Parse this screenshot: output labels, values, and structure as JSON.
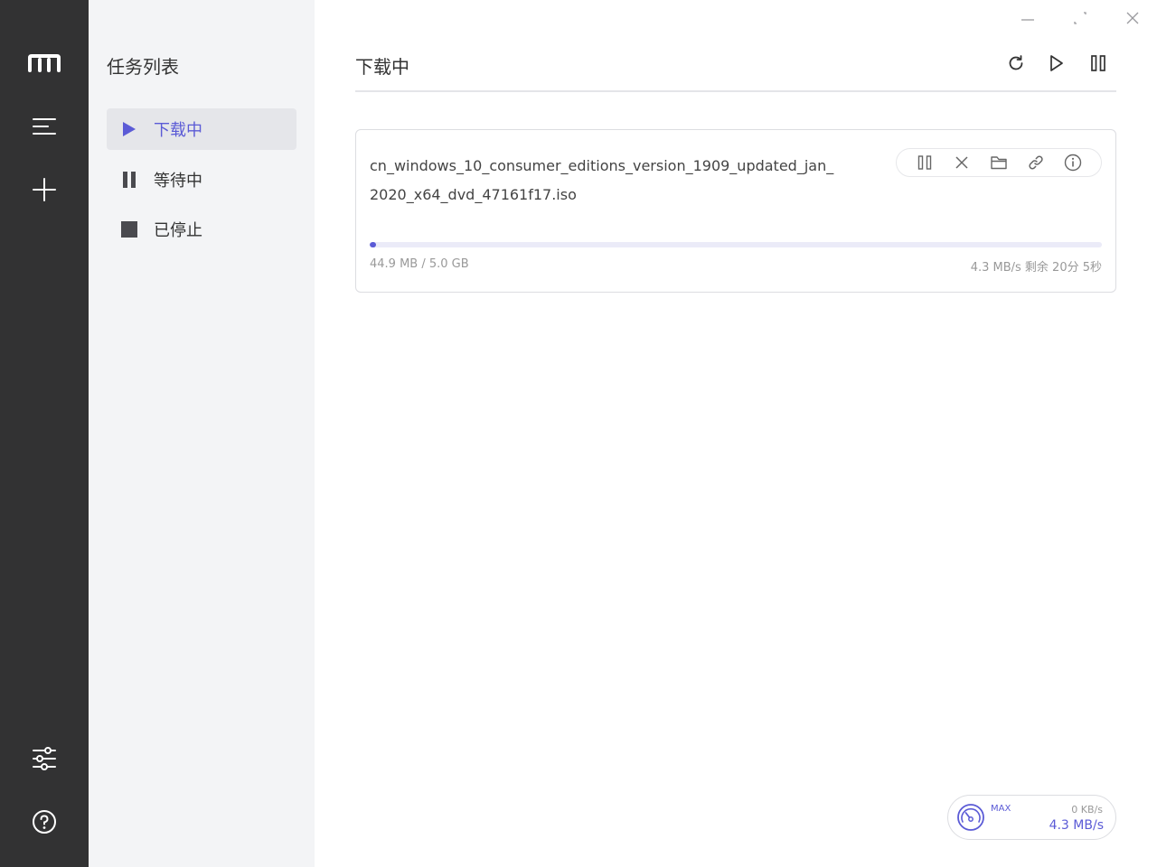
{
  "nav_rail": {
    "icons": [
      "app-logo-icon",
      "menu-icon",
      "add-task-icon",
      "settings-icon",
      "help-icon"
    ]
  },
  "sidebar": {
    "title": "任务列表",
    "items": [
      {
        "label": "下载中",
        "icon": "play-icon",
        "active": true
      },
      {
        "label": "等待中",
        "icon": "pause-icon",
        "active": false
      },
      {
        "label": "已停止",
        "icon": "stop-icon",
        "active": false
      }
    ]
  },
  "header": {
    "title": "下载中",
    "actions": [
      "refresh-icon",
      "resume-all-icon",
      "pause-all-icon"
    ]
  },
  "task": {
    "name": "cn_windows_10_consumer_editions_version_1909_updated_jan_2020_x64_dvd_47161f17.iso",
    "size_text": "44.9 MB / 5.0 GB",
    "speed_text": "4.3 MB/s 剩余 20分 5秒",
    "progress": 0.009,
    "actions": [
      "pause-icon",
      "delete-icon",
      "folder-icon",
      "link-icon",
      "info-icon"
    ]
  },
  "speedometer": {
    "mode": "MAX",
    "upload": "0 KB/s",
    "download": "4.3 MB/s"
  },
  "colors": {
    "rail": "#323233",
    "sidebar": "#f3f4f6",
    "accent": "#5b5bd6"
  }
}
